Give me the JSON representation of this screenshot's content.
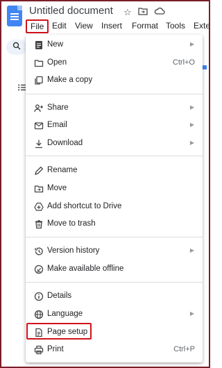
{
  "doc": {
    "title": "Untitled document"
  },
  "menubar": {
    "items": [
      "File",
      "Edit",
      "View",
      "Insert",
      "Format",
      "Tools",
      "Exte"
    ]
  },
  "file_menu": {
    "groups": [
      [
        {
          "label": "New",
          "icon": "document-icon",
          "shortcut": "",
          "submenu": true
        },
        {
          "label": "Open",
          "icon": "folder-icon",
          "shortcut": "Ctrl+O",
          "submenu": false
        },
        {
          "label": "Make a copy",
          "icon": "copy-icon",
          "shortcut": "",
          "submenu": false
        }
      ],
      [
        {
          "label": "Share",
          "icon": "person-add-icon",
          "shortcut": "",
          "submenu": true
        },
        {
          "label": "Email",
          "icon": "mail-icon",
          "shortcut": "",
          "submenu": true
        },
        {
          "label": "Download",
          "icon": "download-icon",
          "shortcut": "",
          "submenu": true
        }
      ],
      [
        {
          "label": "Rename",
          "icon": "edit-icon",
          "shortcut": "",
          "submenu": false
        },
        {
          "label": "Move",
          "icon": "folder-move-icon",
          "shortcut": "",
          "submenu": false
        },
        {
          "label": "Add shortcut to Drive",
          "icon": "drive-shortcut-icon",
          "shortcut": "",
          "submenu": false
        },
        {
          "label": "Move to trash",
          "icon": "trash-icon",
          "shortcut": "",
          "submenu": false
        }
      ],
      [
        {
          "label": "Version history",
          "icon": "history-icon",
          "shortcut": "",
          "submenu": true
        },
        {
          "label": "Make available offline",
          "icon": "offline-icon",
          "shortcut": "",
          "submenu": false
        }
      ],
      [
        {
          "label": "Details",
          "icon": "info-icon",
          "shortcut": "",
          "submenu": false
        },
        {
          "label": "Language",
          "icon": "globe-icon",
          "shortcut": "",
          "submenu": true
        },
        {
          "label": "Page setup",
          "icon": "page-setup-icon",
          "shortcut": "",
          "submenu": false
        },
        {
          "label": "Print",
          "icon": "print-icon",
          "shortcut": "Ctrl+P",
          "submenu": false
        }
      ]
    ]
  },
  "colors": {
    "highlight": "#d0121b",
    "doc_blue": "#4285f4"
  }
}
